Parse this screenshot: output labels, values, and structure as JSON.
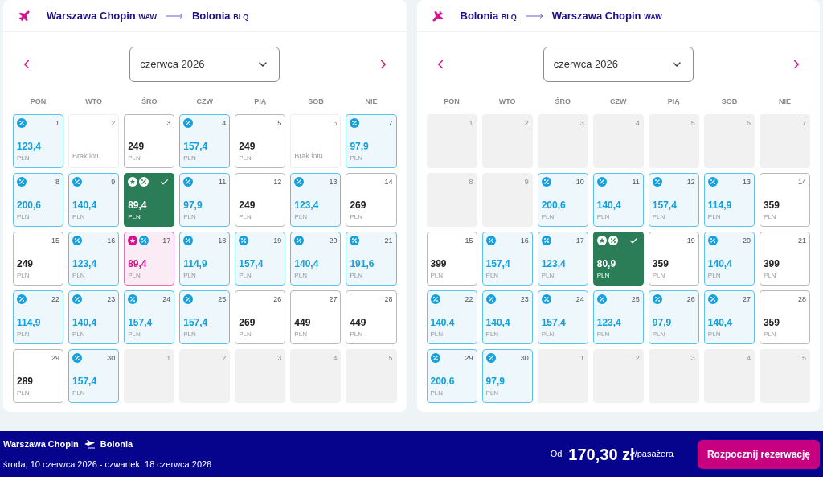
{
  "calendars": [
    {
      "from": {
        "city": "Warszawa Chopin",
        "code": "WAW"
      },
      "to": {
        "city": "Bolonia",
        "code": "BLQ"
      },
      "reversed": false,
      "month": "czerwca 2026",
      "weekdays": [
        "PON",
        "WTO",
        "ŚRO",
        "CZW",
        "PIĄ",
        "SOB",
        "NIE"
      ],
      "days": [
        {
          "day": "1",
          "kind": "discount",
          "price": "123,4",
          "currency": "PLN",
          "selected": false
        },
        {
          "day": "2",
          "kind": "no_flight",
          "note": "Brak lotu",
          "selected": false
        },
        {
          "day": "3",
          "kind": "regular",
          "price": "249",
          "currency": "PLN",
          "selected": false
        },
        {
          "day": "4",
          "kind": "discount",
          "price": "157,4",
          "currency": "PLN",
          "selected": false
        },
        {
          "day": "5",
          "kind": "regular",
          "price": "249",
          "currency": "PLN",
          "selected": false
        },
        {
          "day": "6",
          "kind": "no_flight",
          "note": "Brak lotu",
          "selected": false
        },
        {
          "day": "7",
          "kind": "discount",
          "price": "97,9",
          "currency": "PLN",
          "selected": false
        },
        {
          "day": "8",
          "kind": "discount",
          "price": "200,6",
          "currency": "PLN",
          "selected": false
        },
        {
          "day": "9",
          "kind": "discount",
          "price": "140,4",
          "currency": "PLN",
          "selected": false
        },
        {
          "kind": "promo",
          "price": "89,4",
          "currency": "PLN",
          "selected": true
        },
        {
          "day": "11",
          "kind": "discount",
          "price": "97,9",
          "currency": "PLN",
          "selected": false
        },
        {
          "day": "12",
          "kind": "regular",
          "price": "249",
          "currency": "PLN",
          "selected": false
        },
        {
          "day": "13",
          "kind": "discount",
          "price": "123,4",
          "currency": "PLN",
          "selected": false
        },
        {
          "day": "14",
          "kind": "regular",
          "price": "269",
          "currency": "PLN",
          "selected": false
        },
        {
          "day": "15",
          "kind": "regular",
          "price": "249",
          "currency": "PLN",
          "selected": false
        },
        {
          "day": "16",
          "kind": "discount",
          "price": "123,4",
          "currency": "PLN",
          "selected": false
        },
        {
          "day": "17",
          "kind": "promo",
          "price": "89,4",
          "currency": "PLN",
          "selected": false
        },
        {
          "day": "18",
          "kind": "discount",
          "price": "114,9",
          "currency": "PLN",
          "selected": false
        },
        {
          "day": "19",
          "kind": "discount",
          "price": "157,4",
          "currency": "PLN",
          "selected": false
        },
        {
          "day": "20",
          "kind": "discount",
          "price": "140,4",
          "currency": "PLN",
          "selected": false
        },
        {
          "day": "21",
          "kind": "discount",
          "price": "191,6",
          "currency": "PLN",
          "selected": false
        },
        {
          "day": "22",
          "kind": "discount",
          "price": "114,9",
          "currency": "PLN",
          "selected": false
        },
        {
          "day": "23",
          "kind": "discount",
          "price": "140,4",
          "currency": "PLN",
          "selected": false
        },
        {
          "day": "24",
          "kind": "discount",
          "price": "157,4",
          "currency": "PLN",
          "selected": false
        },
        {
          "day": "25",
          "kind": "discount",
          "price": "157,4",
          "currency": "PLN",
          "selected": false
        },
        {
          "day": "26",
          "kind": "regular",
          "price": "269",
          "currency": "PLN",
          "selected": false
        },
        {
          "day": "27",
          "kind": "regular",
          "price": "449",
          "currency": "PLN",
          "selected": false
        },
        {
          "day": "28",
          "kind": "regular",
          "price": "449",
          "currency": "PLN",
          "selected": false
        },
        {
          "day": "29",
          "kind": "regular",
          "price": "289",
          "currency": "PLN",
          "selected": false
        },
        {
          "day": "30",
          "kind": "discount",
          "price": "157,4",
          "currency": "PLN",
          "selected": false
        },
        {
          "day": "1",
          "kind": "empty",
          "selected": false
        },
        {
          "day": "2",
          "kind": "empty",
          "selected": false
        },
        {
          "day": "3",
          "kind": "empty",
          "selected": false
        },
        {
          "day": "4",
          "kind": "empty",
          "selected": false
        },
        {
          "day": "5",
          "kind": "empty",
          "selected": false
        }
      ]
    },
    {
      "from": {
        "city": "Bolonia",
        "code": "BLQ"
      },
      "to": {
        "city": "Warszawa Chopin",
        "code": "WAW"
      },
      "reversed": true,
      "month": "czerwca 2026",
      "weekdays": [
        "PON",
        "WTO",
        "ŚRO",
        "CZW",
        "PIĄ",
        "SOB",
        "NIE"
      ],
      "days": [
        {
          "day": "1",
          "kind": "empty",
          "selected": false
        },
        {
          "day": "2",
          "kind": "empty",
          "selected": false
        },
        {
          "day": "3",
          "kind": "empty",
          "selected": false
        },
        {
          "day": "4",
          "kind": "empty",
          "selected": false
        },
        {
          "day": "5",
          "kind": "empty",
          "selected": false
        },
        {
          "day": "6",
          "kind": "empty",
          "selected": false
        },
        {
          "day": "7",
          "kind": "empty",
          "selected": false
        },
        {
          "day": "8",
          "kind": "empty",
          "selected": false
        },
        {
          "day": "9",
          "kind": "empty",
          "selected": false
        },
        {
          "day": "10",
          "kind": "discount",
          "price": "200,6",
          "currency": "PLN",
          "selected": false
        },
        {
          "day": "11",
          "kind": "discount",
          "price": "140,4",
          "currency": "PLN",
          "selected": false
        },
        {
          "day": "12",
          "kind": "discount",
          "price": "157,4",
          "currency": "PLN",
          "selected": false
        },
        {
          "day": "13",
          "kind": "discount",
          "price": "114,9",
          "currency": "PLN",
          "selected": false
        },
        {
          "day": "14",
          "kind": "regular",
          "price": "359",
          "currency": "PLN",
          "selected": false
        },
        {
          "day": "15",
          "kind": "regular",
          "price": "399",
          "currency": "PLN",
          "selected": false
        },
        {
          "day": "16",
          "kind": "discount",
          "price": "157,4",
          "currency": "PLN",
          "selected": false
        },
        {
          "day": "17",
          "kind": "discount",
          "price": "123,4",
          "currency": "PLN",
          "selected": false
        },
        {
          "kind": "promo",
          "price": "80,9",
          "currency": "PLN",
          "selected": true
        },
        {
          "day": "19",
          "kind": "regular",
          "price": "359",
          "currency": "PLN",
          "selected": false
        },
        {
          "day": "20",
          "kind": "discount",
          "price": "140,4",
          "currency": "PLN",
          "selected": false
        },
        {
          "day": "21",
          "kind": "regular",
          "price": "399",
          "currency": "PLN",
          "selected": false
        },
        {
          "day": "22",
          "kind": "discount",
          "price": "140,4",
          "currency": "PLN",
          "selected": false
        },
        {
          "day": "23",
          "kind": "discount",
          "price": "140,4",
          "currency": "PLN",
          "selected": false
        },
        {
          "day": "24",
          "kind": "discount",
          "price": "157,4",
          "currency": "PLN",
          "selected": false
        },
        {
          "day": "25",
          "kind": "discount",
          "price": "123,4",
          "currency": "PLN",
          "selected": false
        },
        {
          "day": "26",
          "kind": "discount",
          "price": "97,9",
          "currency": "PLN",
          "selected": false
        },
        {
          "day": "27",
          "kind": "discount",
          "price": "140,4",
          "currency": "PLN",
          "selected": false
        },
        {
          "day": "28",
          "kind": "regular",
          "price": "359",
          "currency": "PLN",
          "selected": false
        },
        {
          "day": "29",
          "kind": "discount",
          "price": "200,6",
          "currency": "PLN",
          "selected": false
        },
        {
          "day": "30",
          "kind": "discount",
          "price": "97,9",
          "currency": "PLN",
          "selected": false
        },
        {
          "day": "1",
          "kind": "empty",
          "selected": false
        },
        {
          "day": "2",
          "kind": "empty",
          "selected": false
        },
        {
          "day": "3",
          "kind": "empty",
          "selected": false
        },
        {
          "day": "4",
          "kind": "empty",
          "selected": false
        },
        {
          "day": "5",
          "kind": "empty",
          "selected": false
        }
      ]
    }
  ],
  "summary": {
    "from": "Warszawa Chopin",
    "to": "Bolonia",
    "dates": "środa, 10 czerwca 2026 - czwartek, 18 czerwca 2026",
    "price_prefix": "Od",
    "price": "170,30 zł",
    "price_suffix": "/pasażera",
    "button": "Rozpocznij rezerwację"
  }
}
